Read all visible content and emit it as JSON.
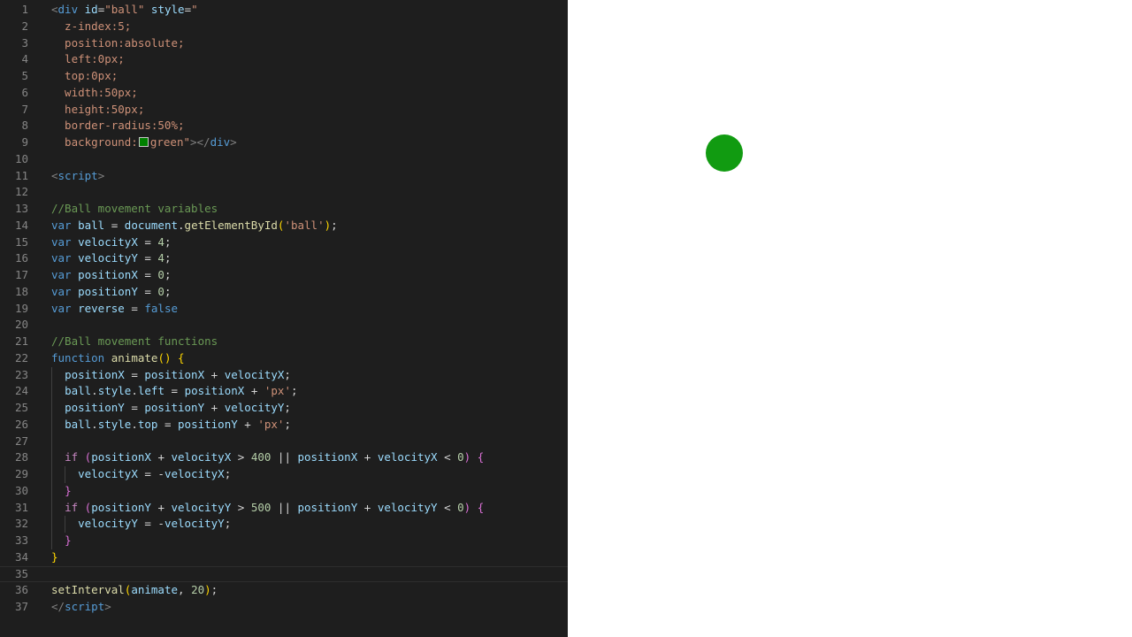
{
  "editor": {
    "line_numbers": [
      "1",
      "2",
      "3",
      "4",
      "5",
      "6",
      "7",
      "8",
      "9",
      "10",
      "11",
      "12",
      "13",
      "14",
      "15",
      "16",
      "17",
      "18",
      "19",
      "20",
      "21",
      "22",
      "23",
      "24",
      "25",
      "26",
      "27",
      "28",
      "29",
      "30",
      "31",
      "32",
      "33",
      "34",
      "35",
      "36",
      "37"
    ],
    "lines": [
      [
        {
          "t": "<",
          "c": "tg"
        },
        {
          "t": "div",
          "c": "tn"
        },
        {
          "t": " ",
          "c": "pl"
        },
        {
          "t": "id",
          "c": "at"
        },
        {
          "t": "=",
          "c": "pl"
        },
        {
          "t": "\"ball\"",
          "c": "st"
        },
        {
          "t": " ",
          "c": "pl"
        },
        {
          "t": "style",
          "c": "at"
        },
        {
          "t": "=",
          "c": "pl"
        },
        {
          "t": "\"",
          "c": "st"
        }
      ],
      [
        {
          "t": "  z-index:5;",
          "c": "st"
        }
      ],
      [
        {
          "t": "  position:absolute;",
          "c": "st"
        }
      ],
      [
        {
          "t": "  left:0px;",
          "c": "st"
        }
      ],
      [
        {
          "t": "  top:0px;",
          "c": "st"
        }
      ],
      [
        {
          "t": "  width:50px;",
          "c": "st"
        }
      ],
      [
        {
          "t": "  height:50px;",
          "c": "st"
        }
      ],
      [
        {
          "t": "  border-radius:50%;",
          "c": "st"
        }
      ],
      [
        {
          "t": "  background:",
          "c": "st"
        },
        {
          "t": "",
          "c": "swatch"
        },
        {
          "t": "green\"",
          "c": "st"
        },
        {
          "t": "></",
          "c": "tg"
        },
        {
          "t": "div",
          "c": "tn"
        },
        {
          "t": ">",
          "c": "tg"
        }
      ],
      [],
      [
        {
          "t": "<",
          "c": "tg"
        },
        {
          "t": "script",
          "c": "tn"
        },
        {
          "t": ">",
          "c": "tg"
        }
      ],
      [],
      [
        {
          "t": "//Ball movement variables",
          "c": "cm"
        }
      ],
      [
        {
          "t": "var",
          "c": "kw"
        },
        {
          "t": " ",
          "c": "pl"
        },
        {
          "t": "ball",
          "c": "vr"
        },
        {
          "t": " = ",
          "c": "pl"
        },
        {
          "t": "document",
          "c": "vr"
        },
        {
          "t": ".",
          "c": "pl"
        },
        {
          "t": "getElementById",
          "c": "fn"
        },
        {
          "t": "(",
          "c": "b1"
        },
        {
          "t": "'ball'",
          "c": "st"
        },
        {
          "t": ")",
          "c": "b1"
        },
        {
          "t": ";",
          "c": "pl"
        }
      ],
      [
        {
          "t": "var",
          "c": "kw"
        },
        {
          "t": " ",
          "c": "pl"
        },
        {
          "t": "velocityX",
          "c": "vr"
        },
        {
          "t": " = ",
          "c": "pl"
        },
        {
          "t": "4",
          "c": "nu"
        },
        {
          "t": ";",
          "c": "pl"
        }
      ],
      [
        {
          "t": "var",
          "c": "kw"
        },
        {
          "t": " ",
          "c": "pl"
        },
        {
          "t": "velocityY",
          "c": "vr"
        },
        {
          "t": " = ",
          "c": "pl"
        },
        {
          "t": "4",
          "c": "nu"
        },
        {
          "t": ";",
          "c": "pl"
        }
      ],
      [
        {
          "t": "var",
          "c": "kw"
        },
        {
          "t": " ",
          "c": "pl"
        },
        {
          "t": "positionX",
          "c": "vr"
        },
        {
          "t": " = ",
          "c": "pl"
        },
        {
          "t": "0",
          "c": "nu"
        },
        {
          "t": ";",
          "c": "pl"
        }
      ],
      [
        {
          "t": "var",
          "c": "kw"
        },
        {
          "t": " ",
          "c": "pl"
        },
        {
          "t": "positionY",
          "c": "vr"
        },
        {
          "t": " = ",
          "c": "pl"
        },
        {
          "t": "0",
          "c": "nu"
        },
        {
          "t": ";",
          "c": "pl"
        }
      ],
      [
        {
          "t": "var",
          "c": "kw"
        },
        {
          "t": " ",
          "c": "pl"
        },
        {
          "t": "reverse",
          "c": "vr"
        },
        {
          "t": " = ",
          "c": "pl"
        },
        {
          "t": "false",
          "c": "kw"
        }
      ],
      [],
      [
        {
          "t": "//Ball movement functions",
          "c": "cm"
        }
      ],
      [
        {
          "t": "function",
          "c": "kw"
        },
        {
          "t": " ",
          "c": "pl"
        },
        {
          "t": "animate",
          "c": "fn"
        },
        {
          "t": "()",
          "c": "b1"
        },
        {
          "t": " ",
          "c": "pl"
        },
        {
          "t": "{",
          "c": "b1"
        }
      ],
      [
        {
          "t": "  ",
          "c": "pl"
        },
        {
          "t": "positionX",
          "c": "vr"
        },
        {
          "t": " = ",
          "c": "pl"
        },
        {
          "t": "positionX",
          "c": "vr"
        },
        {
          "t": " + ",
          "c": "pl"
        },
        {
          "t": "velocityX",
          "c": "vr"
        },
        {
          "t": ";",
          "c": "pl"
        }
      ],
      [
        {
          "t": "  ",
          "c": "pl"
        },
        {
          "t": "ball",
          "c": "vr"
        },
        {
          "t": ".",
          "c": "pl"
        },
        {
          "t": "style",
          "c": "vr"
        },
        {
          "t": ".",
          "c": "pl"
        },
        {
          "t": "left",
          "c": "vr"
        },
        {
          "t": " = ",
          "c": "pl"
        },
        {
          "t": "positionX",
          "c": "vr"
        },
        {
          "t": " + ",
          "c": "pl"
        },
        {
          "t": "'px'",
          "c": "st"
        },
        {
          "t": ";",
          "c": "pl"
        }
      ],
      [
        {
          "t": "  ",
          "c": "pl"
        },
        {
          "t": "positionY",
          "c": "vr"
        },
        {
          "t": " = ",
          "c": "pl"
        },
        {
          "t": "positionY",
          "c": "vr"
        },
        {
          "t": " + ",
          "c": "pl"
        },
        {
          "t": "velocityY",
          "c": "vr"
        },
        {
          "t": ";",
          "c": "pl"
        }
      ],
      [
        {
          "t": "  ",
          "c": "pl"
        },
        {
          "t": "ball",
          "c": "vr"
        },
        {
          "t": ".",
          "c": "pl"
        },
        {
          "t": "style",
          "c": "vr"
        },
        {
          "t": ".",
          "c": "pl"
        },
        {
          "t": "top",
          "c": "vr"
        },
        {
          "t": " = ",
          "c": "pl"
        },
        {
          "t": "positionY",
          "c": "vr"
        },
        {
          "t": " + ",
          "c": "pl"
        },
        {
          "t": "'px'",
          "c": "st"
        },
        {
          "t": ";",
          "c": "pl"
        }
      ],
      [],
      [
        {
          "t": "  ",
          "c": "pl"
        },
        {
          "t": "if",
          "c": "cf"
        },
        {
          "t": " ",
          "c": "pl"
        },
        {
          "t": "(",
          "c": "b2"
        },
        {
          "t": "positionX",
          "c": "vr"
        },
        {
          "t": " + ",
          "c": "pl"
        },
        {
          "t": "velocityX",
          "c": "vr"
        },
        {
          "t": " > ",
          "c": "pl"
        },
        {
          "t": "400",
          "c": "nu"
        },
        {
          "t": " || ",
          "c": "pl"
        },
        {
          "t": "positionX",
          "c": "vr"
        },
        {
          "t": " + ",
          "c": "pl"
        },
        {
          "t": "velocityX",
          "c": "vr"
        },
        {
          "t": " < ",
          "c": "pl"
        },
        {
          "t": "0",
          "c": "nu"
        },
        {
          "t": ")",
          "c": "b2"
        },
        {
          "t": " ",
          "c": "pl"
        },
        {
          "t": "{",
          "c": "b2"
        }
      ],
      [
        {
          "t": "    ",
          "c": "pl"
        },
        {
          "t": "velocityX",
          "c": "vr"
        },
        {
          "t": " = -",
          "c": "pl"
        },
        {
          "t": "velocityX",
          "c": "vr"
        },
        {
          "t": ";",
          "c": "pl"
        }
      ],
      [
        {
          "t": "  ",
          "c": "pl"
        },
        {
          "t": "}",
          "c": "b2"
        }
      ],
      [
        {
          "t": "  ",
          "c": "pl"
        },
        {
          "t": "if",
          "c": "cf"
        },
        {
          "t": " ",
          "c": "pl"
        },
        {
          "t": "(",
          "c": "b2"
        },
        {
          "t": "positionY",
          "c": "vr"
        },
        {
          "t": " + ",
          "c": "pl"
        },
        {
          "t": "velocityY",
          "c": "vr"
        },
        {
          "t": " > ",
          "c": "pl"
        },
        {
          "t": "500",
          "c": "nu"
        },
        {
          "t": " || ",
          "c": "pl"
        },
        {
          "t": "positionY",
          "c": "vr"
        },
        {
          "t": " + ",
          "c": "pl"
        },
        {
          "t": "velocityY",
          "c": "vr"
        },
        {
          "t": " < ",
          "c": "pl"
        },
        {
          "t": "0",
          "c": "nu"
        },
        {
          "t": ")",
          "c": "b2"
        },
        {
          "t": " ",
          "c": "pl"
        },
        {
          "t": "{",
          "c": "b2"
        }
      ],
      [
        {
          "t": "    ",
          "c": "pl"
        },
        {
          "t": "velocityY",
          "c": "vr"
        },
        {
          "t": " = -",
          "c": "pl"
        },
        {
          "t": "velocityY",
          "c": "vr"
        },
        {
          "t": ";",
          "c": "pl"
        }
      ],
      [
        {
          "t": "  ",
          "c": "pl"
        },
        {
          "t": "}",
          "c": "b2"
        }
      ],
      [
        {
          "t": "}",
          "c": "b1"
        }
      ],
      [],
      [
        {
          "t": "setInterval",
          "c": "fn"
        },
        {
          "t": "(",
          "c": "b1"
        },
        {
          "t": "animate",
          "c": "vr"
        },
        {
          "t": ", ",
          "c": "pl"
        },
        {
          "t": "20",
          "c": "nu"
        },
        {
          "t": ")",
          "c": "b1"
        },
        {
          "t": ";",
          "c": "pl"
        }
      ],
      [
        {
          "t": "</",
          "c": "tg"
        },
        {
          "t": "script",
          "c": "tn"
        },
        {
          "t": ">",
          "c": "tg"
        }
      ]
    ],
    "current_line": 35,
    "swatch_color": "#008000"
  },
  "preview": {
    "ball_color": "#119b11"
  }
}
